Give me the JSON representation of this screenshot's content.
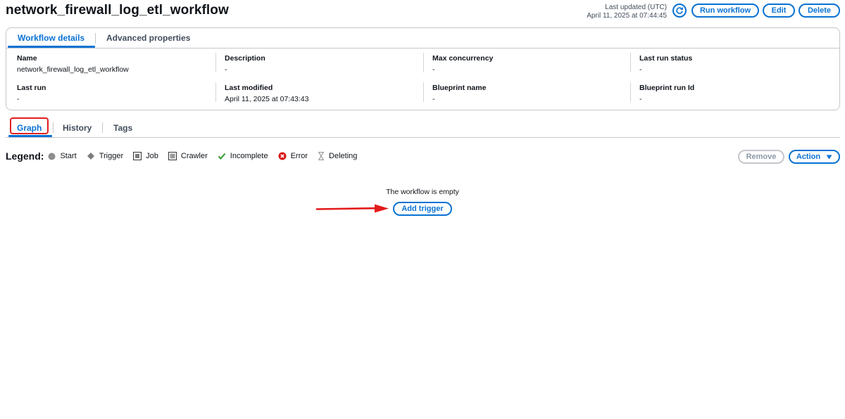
{
  "header": {
    "title": "network_firewall_log_etl_workflow",
    "last_updated_label": "Last updated (UTC)",
    "last_updated_value": "April 11, 2025 at 07:44:45",
    "run_label": "Run workflow",
    "edit_label": "Edit",
    "delete_label": "Delete"
  },
  "details": {
    "tabs": [
      "Workflow details",
      "Advanced properties"
    ],
    "fields": {
      "name": {
        "label": "Name",
        "value": "network_firewall_log_etl_workflow"
      },
      "description": {
        "label": "Description",
        "value": "-"
      },
      "max_concurrency": {
        "label": "Max concurrency",
        "value": "-"
      },
      "last_run_status": {
        "label": "Last run status",
        "value": "-"
      },
      "last_run": {
        "label": "Last run",
        "value": "-"
      },
      "last_modified": {
        "label": "Last modified",
        "value": "April 11, 2025 at 07:43:43"
      },
      "blueprint_name": {
        "label": "Blueprint name",
        "value": "-"
      },
      "blueprint_run_id": {
        "label": "Blueprint run Id",
        "value": "-"
      }
    }
  },
  "graph_tabs": [
    "Graph",
    "History",
    "Tags"
  ],
  "legend": {
    "title": "Legend:",
    "items": [
      "Start",
      "Trigger",
      "Job",
      "Crawler",
      "Incomplete",
      "Error",
      "Deleting"
    ]
  },
  "graph_actions": {
    "remove_label": "Remove",
    "action_label": "Action"
  },
  "empty_state": {
    "message": "The workflow is empty",
    "add_trigger_label": "Add trigger"
  },
  "colors": {
    "accent": "#0972d3",
    "highlight": "#e02020",
    "success": "#037f0c",
    "error": "#d91515"
  }
}
